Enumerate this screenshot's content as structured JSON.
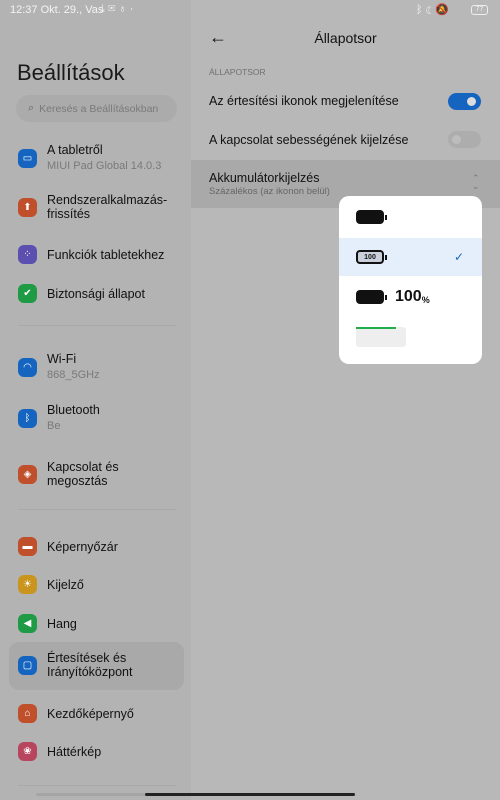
{
  "status": {
    "left": "12:37 Okt. 29., Vas",
    "left_icons": [
      "download-icon",
      "mail-icon",
      "bulb-icon",
      "dot-icon"
    ],
    "right_icons": [
      "bluetooth-icon",
      "moon-icon",
      "bell-off-icon",
      "wifi-icon"
    ],
    "battery": "77"
  },
  "sidebar": {
    "title": "Beállítások",
    "search_placeholder": "Keresés a Beállításokban",
    "items": [
      {
        "label": "A tabletről",
        "sub": "MIUI Pad Global 14.0.3",
        "color": "#1565c0",
        "icon": "tablet-icon"
      },
      {
        "label": "Rendszeralkalmazás-frissítés",
        "color": "#c0502b",
        "icon": "arrow-up-icon"
      },
      {
        "label": "Funkciók tabletekhez",
        "color": "#5b4fb0",
        "icon": "grid-icon"
      },
      {
        "label": "Biztonsági állapot",
        "color": "#1f9a45",
        "icon": "shield-check-icon"
      },
      {
        "label": "Wi-Fi",
        "sub": "868_5GHz",
        "color": "#1565c0",
        "icon": "wifi-icon"
      },
      {
        "label": "Bluetooth",
        "sub": "Be",
        "color": "#1565c0",
        "icon": "bluetooth-icon"
      },
      {
        "label": "Kapcsolat és megosztás",
        "color": "#c0502b",
        "icon": "share-icon"
      },
      {
        "label": "Képernyőzár",
        "color": "#c0502b",
        "icon": "lock-icon"
      },
      {
        "label": "Kijelző",
        "color": "#c9951f",
        "icon": "sun-icon"
      },
      {
        "label": "Hang",
        "color": "#1f9a45",
        "icon": "speaker-icon"
      },
      {
        "label": "Értesítések és Irányítóközpont",
        "color": "#1565c0",
        "icon": "notification-icon",
        "selected": true
      },
      {
        "label": "Kezdőképernyő",
        "color": "#c0502b",
        "icon": "home-icon"
      },
      {
        "label": "Háttérkép",
        "color": "#b8455e",
        "icon": "wallpaper-icon"
      }
    ]
  },
  "main": {
    "title": "Állapotsor",
    "section": "ÁLLAPOTSOR",
    "rows": [
      {
        "label": "Az értesítési ikonok megjelenítése",
        "toggle": true
      },
      {
        "label": "A kapcsolat sebességének kijelzése",
        "toggle": false
      }
    ],
    "battery_row": {
      "label": "Akkumulátorkijelzés",
      "value": "Százalékos (az ikonon belül)"
    },
    "options": [
      {
        "type": "icon",
        "selected": false
      },
      {
        "type": "percent-inside",
        "text": "100",
        "selected": true
      },
      {
        "type": "percent-outside",
        "text": "100",
        "unit": "%",
        "selected": false
      },
      {
        "type": "bar",
        "selected": false
      }
    ],
    "accent": "#1565c0"
  }
}
